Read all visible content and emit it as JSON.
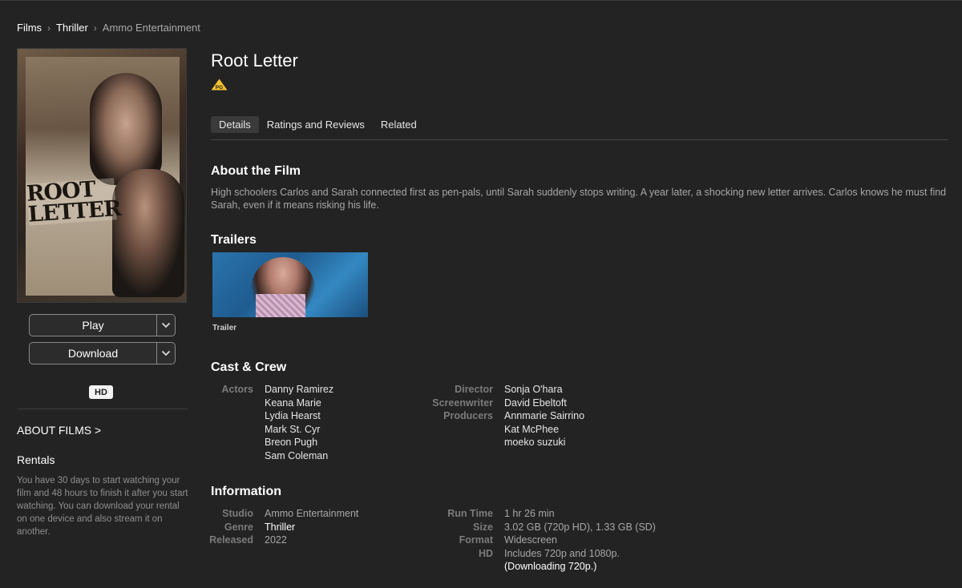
{
  "breadcrumb": [
    {
      "label": "Films",
      "current": false
    },
    {
      "label": "Thriller",
      "current": false
    },
    {
      "label": "Ammo Entertainment",
      "current": true
    }
  ],
  "poster": {
    "title_art": "ROOT LETTER"
  },
  "actions": {
    "play_label": "Play",
    "download_label": "Download"
  },
  "badges": {
    "hd": "HD",
    "rating": "PG"
  },
  "sidebar": {
    "about_films": "ABOUT FILMS >",
    "rentals_title": "Rentals",
    "rentals_body": "You have 30 days to start watching your film and 48 hours to finish it after you start watching. You can download your rental on one device and also stream it on another."
  },
  "film": {
    "title": "Root Letter"
  },
  "tabs": [
    {
      "label": "Details",
      "active": true
    },
    {
      "label": "Ratings and Reviews",
      "active": false
    },
    {
      "label": "Related",
      "active": false
    }
  ],
  "about": {
    "title": "About the Film",
    "description": "High schoolers Carlos and Sarah connected first as pen-pals, until Sarah suddenly stops writing. A year later, a shocking new letter arrives. Carlos knows he must find Sarah, even if it means risking his life."
  },
  "trailers": {
    "title": "Trailers",
    "items": [
      {
        "label": "Trailer"
      }
    ]
  },
  "cast": {
    "title": "Cast & Crew",
    "actors_label": "Actors",
    "actors": [
      "Danny Ramirez",
      "Keana Marie",
      "Lydia Hearst",
      "Mark St. Cyr",
      "Breon Pugh",
      "Sam Coleman"
    ],
    "director_label": "Director",
    "director": "Sonja O'hara",
    "screenwriter_label": "Screenwriter",
    "screenwriter": "David Ebeltoft",
    "producers_label": "Producers",
    "producers": [
      "Annmarie Sairrino",
      "Kat McPhee",
      "moeko suzuki"
    ]
  },
  "information": {
    "title": "Information",
    "studio_label": "Studio",
    "studio": "Ammo Entertainment",
    "genre_label": "Genre",
    "genre": "Thriller",
    "released_label": "Released",
    "released": "2022",
    "runtime_label": "Run Time",
    "runtime": "1 hr 26 min",
    "size_label": "Size",
    "size": "3.02 GB (720p HD), 1.33 GB (SD)",
    "format_label": "Format",
    "format": "Widescreen",
    "hd_label": "HD",
    "hd_line1": "Includes 720p and 1080p.",
    "hd_line2": "(Downloading 720p.)"
  },
  "colors": {
    "background": "#232323",
    "accent_text": "#ffffff",
    "muted_text": "#7b7b7b",
    "pg_badge": "#f2c230"
  },
  "icons": {
    "dropdown": "chevron-down-icon",
    "breadcrumb_separator": "chevron-right-icon"
  }
}
